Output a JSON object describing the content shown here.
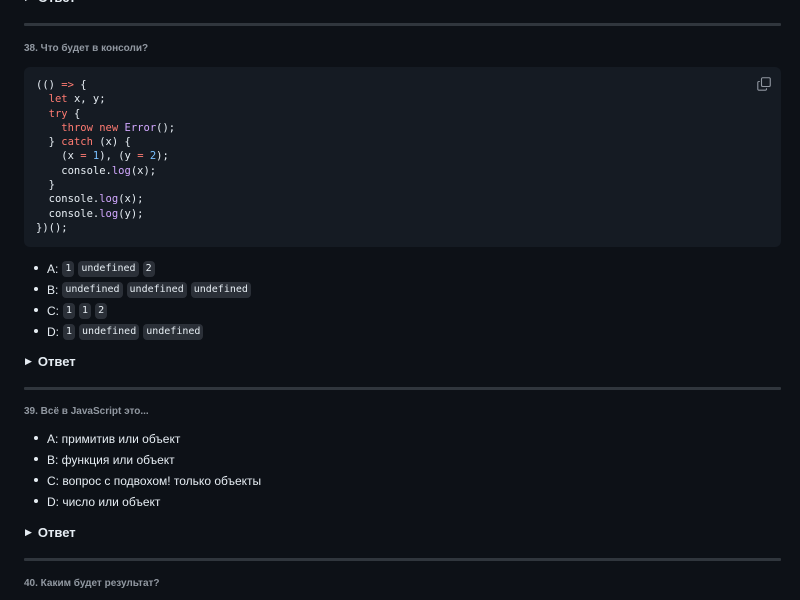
{
  "answer_label": "Ответ",
  "q38": {
    "title": "38. Что будет в консоли?",
    "code_lines": [
      [
        {
          "t": "(() "
        },
        {
          "t": "=>",
          "c": "k"
        },
        {
          "t": " {"
        }
      ],
      [
        {
          "t": "  "
        },
        {
          "t": "let",
          "c": "k"
        },
        {
          "t": " x, y;"
        }
      ],
      [
        {
          "t": "  "
        },
        {
          "t": "try",
          "c": "k"
        },
        {
          "t": " {"
        }
      ],
      [
        {
          "t": "    "
        },
        {
          "t": "throw",
          "c": "k"
        },
        {
          "t": " "
        },
        {
          "t": "new",
          "c": "k"
        },
        {
          "t": " "
        },
        {
          "t": "Error",
          "c": "f"
        },
        {
          "t": "();"
        }
      ],
      [
        {
          "t": "  } "
        },
        {
          "t": "catch",
          "c": "k"
        },
        {
          "t": " (x) {"
        }
      ],
      [
        {
          "t": "    (x "
        },
        {
          "t": "=",
          "c": "k"
        },
        {
          "t": " "
        },
        {
          "t": "1",
          "c": "c"
        },
        {
          "t": "), (y "
        },
        {
          "t": "=",
          "c": "k"
        },
        {
          "t": " "
        },
        {
          "t": "2",
          "c": "c"
        },
        {
          "t": ");"
        }
      ],
      [
        {
          "t": "    console."
        },
        {
          "t": "log",
          "c": "f"
        },
        {
          "t": "(x);"
        }
      ],
      [
        {
          "t": "  }"
        }
      ],
      [
        {
          "t": "  console."
        },
        {
          "t": "log",
          "c": "f"
        },
        {
          "t": "(x);"
        }
      ],
      [
        {
          "t": "  console."
        },
        {
          "t": "log",
          "c": "f"
        },
        {
          "t": "(y);"
        }
      ],
      [
        {
          "t": "})();"
        }
      ]
    ],
    "options": [
      {
        "label": "A:",
        "chips": [
          "1",
          "undefined",
          "2"
        ]
      },
      {
        "label": "B:",
        "chips": [
          "undefined",
          "undefined",
          "undefined"
        ]
      },
      {
        "label": "C:",
        "chips": [
          "1",
          "1",
          "2"
        ]
      },
      {
        "label": "D:",
        "chips": [
          "1",
          "undefined",
          "undefined"
        ]
      }
    ]
  },
  "q39": {
    "title": "39. Всё в JavaScript это...",
    "options": [
      "A: примитив или объект",
      "B: функция или объект",
      "C: вопрос с подвохом! только объекты",
      "D: число или объект"
    ]
  },
  "q40": {
    "title": "40. Каким будет результат?"
  },
  "colors": {
    "background": "#0d1117",
    "code_background": "#151b23",
    "keyword": "#ff7b72",
    "function": "#d2a8ff",
    "constant": "#79c0ff",
    "chip_background": "#2b3038"
  },
  "icons": {
    "disclosure": "triangle-right-icon",
    "copy": "copy-icon"
  }
}
